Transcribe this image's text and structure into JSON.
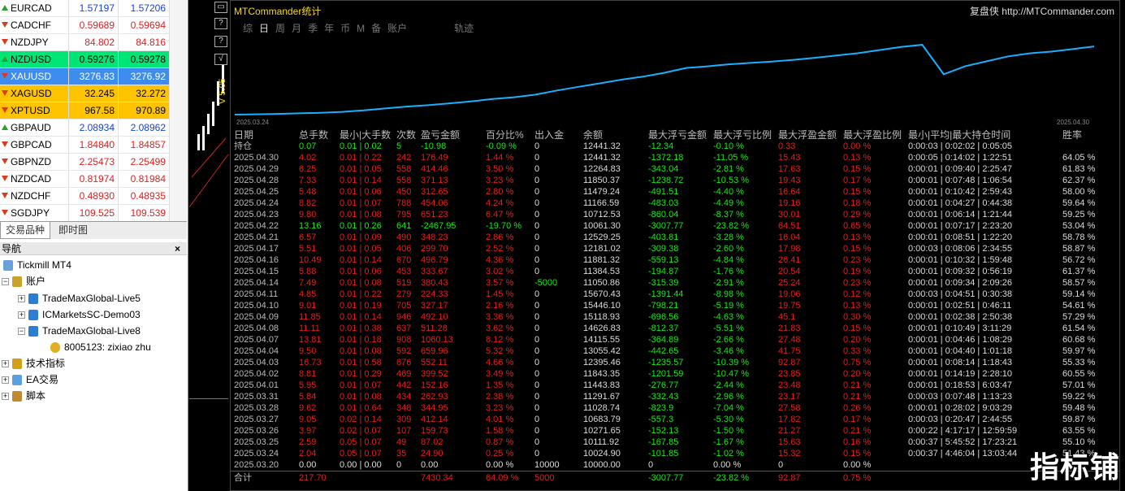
{
  "market_watch": {
    "rows": [
      {
        "sym": "EURCAD",
        "bid": "1.57197",
        "ask": "1.57206",
        "dir": "up",
        "hl": ""
      },
      {
        "sym": "CADCHF",
        "bid": "0.59689",
        "ask": "0.59694",
        "dir": "dn",
        "hl": ""
      },
      {
        "sym": "NZDJPY",
        "bid": "84.802",
        "ask": "84.816",
        "dir": "dn",
        "hl": ""
      },
      {
        "sym": "NZDUSD",
        "bid": "0.59276",
        "ask": "0.59278",
        "dir": "up",
        "hl": "green"
      },
      {
        "sym": "XAUUSD",
        "bid": "3276.83",
        "ask": "3276.92",
        "dir": "dn",
        "hl": "blue"
      },
      {
        "sym": "XAGUSD",
        "bid": "32.245",
        "ask": "32.272",
        "dir": "dn",
        "hl": "orange"
      },
      {
        "sym": "XPTUSD",
        "bid": "967.58",
        "ask": "970.89",
        "dir": "dn",
        "hl": "orange"
      },
      {
        "sym": "GBPAUD",
        "bid": "2.08934",
        "ask": "2.08962",
        "dir": "up",
        "hl": ""
      },
      {
        "sym": "GBPCAD",
        "bid": "1.84840",
        "ask": "1.84857",
        "dir": "dn",
        "hl": ""
      },
      {
        "sym": "GBPNZD",
        "bid": "2.25473",
        "ask": "2.25499",
        "dir": "dn",
        "hl": ""
      },
      {
        "sym": "NZDCAD",
        "bid": "0.81974",
        "ask": "0.81984",
        "dir": "dn",
        "hl": ""
      },
      {
        "sym": "NZDCHF",
        "bid": "0.48930",
        "ask": "0.48935",
        "dir": "dn",
        "hl": ""
      },
      {
        "sym": "SGDJPY",
        "bid": "109.525",
        "ask": "109.539",
        "dir": "dn",
        "hl": ""
      }
    ],
    "tabs": [
      "交易品种",
      "即时图"
    ]
  },
  "navigator": {
    "title": "导航",
    "broker": "Tickmill MT4",
    "accounts": "账户",
    "acc1": "TradeMaxGlobal-Live5",
    "acc2": "ICMarketsSC-Demo03",
    "acc3": "TradeMaxGlobal-Live8",
    "acc3_user": "8005123: zixiao zhu",
    "indicators": "技术指标",
    "ea": "EA交易",
    "scripts": "脚本"
  },
  "toolbar_buttons": [
    "▭",
    "?",
    "?",
    "√"
  ],
  "vertical_label": "V 5.05",
  "panel": {
    "title": "MTCommander统计",
    "link_prefix": "复盘侠",
    "link": "http://MTCommander.com",
    "tabs": [
      "综",
      "日",
      "周",
      "月",
      "季",
      "年",
      "币",
      "M",
      "备",
      "账户"
    ],
    "active_tab": "日",
    "track": "轨迹",
    "graph_start": "2025.03.24",
    "graph_end": "2025.04.30",
    "curve": [
      0,
      0.4,
      1.0,
      1.7,
      2.4,
      3.6,
      5.5,
      8.1,
      10.5,
      12.3,
      14.8,
      17.3,
      20.4,
      22.8,
      26.2,
      31.6,
      36.4,
      41.0,
      45.7,
      49.7,
      54.8,
      61.1,
      63.2,
      65.9,
      67.7,
      69.5,
      71.7,
      74.4,
      77.3,
      80.3,
      84.5,
      88.5,
      91.4,
      52.8,
      63.4,
      69.8,
      76.3,
      80.2,
      82.5,
      85.7,
      89.3
    ],
    "headers": [
      "日期",
      "总手数",
      "最小|大手数",
      "次数",
      "盈亏金额",
      "百分比%",
      "出入金",
      "余额",
      "最大浮亏金额",
      "最大浮亏比例",
      "最大浮盈金额",
      "最大浮盈比例",
      "最小|平均|最大持仓时间",
      "胜率"
    ],
    "holding": {
      "label": "持仓",
      "lots": "0.07",
      "minmax": "0.01 | 0.02",
      "count": "5",
      "pnl": "-10.98",
      "pct": "-0.09 %",
      "dep": "0",
      "bal": "12441.32",
      "mfl": "-12.34",
      "mflp": "-0.10 %",
      "mfp": "0.33",
      "mfpp": "0.00 %",
      "time": "0:00:03 | 0:02:02 | 0:05:05",
      "win": ""
    },
    "rows": [
      [
        "2025.04.30",
        "4.02",
        "0.01 | 0.22",
        "242",
        "176.49",
        "1.44 %",
        "0",
        "12441.32",
        "-1372.18",
        "-11.05 %",
        "15.43",
        "0.13 %",
        "0:00:05 | 0:14:02 | 1:22:51",
        "64.05 %"
      ],
      [
        "2025.04.29",
        "6.25",
        "0.01 | 0.05",
        "558",
        "414.46",
        "3.50 %",
        "0",
        "12264.83",
        "-343.04",
        "-2.81 %",
        "17.63",
        "0.15 %",
        "0:00:01 | 0:09:40 | 2:25:47",
        "61.83 %"
      ],
      [
        "2025.04.28",
        "7.33",
        "0.01 | 0.14",
        "558",
        "371.13",
        "3.23 %",
        "0",
        "11850.37",
        "-1238.72",
        "-10.53 %",
        "19.43",
        "0.17 %",
        "0:00:01 | 0:07:48 | 1:06:54",
        "62.37 %"
      ],
      [
        "2025.04.25",
        "5.48",
        "0.01 | 0.06",
        "450",
        "312.65",
        "2.80 %",
        "0",
        "11479.24",
        "-491.51",
        "-4.40 %",
        "16.64",
        "0.15 %",
        "0:00:01 | 0:10:42 | 2:59:43",
        "58.00 %"
      ],
      [
        "2025.04.24",
        "8.82",
        "0.01 | 0.07",
        "788",
        "454.06",
        "4.24 %",
        "0",
        "11166.59",
        "-483.03",
        "-4.49 %",
        "19.16",
        "0.18 %",
        "0:00:01 | 0:04:27 | 0:44:38",
        "59.64 %"
      ],
      [
        "2025.04.23",
        "9.80",
        "0.01 | 0.08",
        "795",
        "651.23",
        "6.47 %",
        "0",
        "10712.53",
        "-860.04",
        "-8.37 %",
        "30.01",
        "0.29 %",
        "0:00:01 | 0:06:14 | 1:21:44",
        "59.25 %"
      ],
      [
        "2025.04.22",
        "13.16",
        "0.01 | 0.26",
        "641",
        "-2467.95",
        "-19.70 %",
        "0",
        "10061.30",
        "-3007.77",
        "-23.82 %",
        "64.51",
        "0.65 %",
        "0:00:01 | 0:07:17 | 2:23:20",
        "53.04 %"
      ],
      [
        "2025.04.21",
        "6.57",
        "0.01 | 0.09",
        "490",
        "348.23",
        "2.86 %",
        "0",
        "12529.25",
        "-403.81",
        "-3.28 %",
        "16.04",
        "0.13 %",
        "0:00:01 | 0:08:51 | 1:22:20",
        "58.78 %"
      ],
      [
        "2025.04.17",
        "5.51",
        "0.01 | 0.05",
        "406",
        "299.70",
        "2.52 %",
        "0",
        "12181.02",
        "-309.38",
        "-2.60 %",
        "17.98",
        "0.15 %",
        "0:00:03 | 0:08:06 | 2:34:55",
        "58.87 %"
      ],
      [
        "2025.04.16",
        "10.49",
        "0.01 | 0.14",
        "670",
        "496.79",
        "4.36 %",
        "0",
        "11881.32",
        "-559.13",
        "-4.84 %",
        "26.41",
        "0.23 %",
        "0:00:01 | 0:10:32 | 1:59:48",
        "56.72 %"
      ],
      [
        "2025.04.15",
        "5.88",
        "0.01 | 0.06",
        "453",
        "333.67",
        "3.02 %",
        "0",
        "11384.53",
        "-194.87",
        "-1.76 %",
        "20.54",
        "0.19 %",
        "0:00:01 | 0:09:32 | 0:56:19",
        "61.37 %"
      ],
      [
        "2025.04.14",
        "7.49",
        "0.01 | 0.08",
        "519",
        "380.43",
        "3.57 %",
        "-5000",
        "11050.86",
        "-315.39",
        "-2.91 %",
        "25.24",
        "0.23 %",
        "0:00:01 | 0:09:34 | 2:09:26",
        "58.57 %"
      ],
      [
        "2025.04.11",
        "4.85",
        "0.01 | 0.22",
        "279",
        "224.33",
        "1.45 %",
        "0",
        "15670.43",
        "-1391.44",
        "-8.98 %",
        "19.06",
        "0.12 %",
        "0:00:03 | 0:04:51 | 0:30:38",
        "59.14 %"
      ],
      [
        "2025.04.10",
        "9.01",
        "0.01 | 0.19",
        "705",
        "327.17",
        "2.16 %",
        "0",
        "15446.10",
        "-798.21",
        "-5.19 %",
        "19.75",
        "0.13 %",
        "0:00:01 | 0:02:51 | 0:46:11",
        "54.61 %"
      ],
      [
        "2025.04.09",
        "11.85",
        "0.01 | 0.14",
        "946",
        "492.10",
        "3.36 %",
        "0",
        "15118.93",
        "-696.56",
        "-4.63 %",
        "45.1",
        "0.30 %",
        "0:00:01 | 0:02:38 | 2:50:38",
        "57.29 %"
      ],
      [
        "2025.04.08",
        "11.11",
        "0.01 | 0.38",
        "637",
        "511.28",
        "3.62 %",
        "0",
        "14626.83",
        "-812.37",
        "-5.51 %",
        "21.83",
        "0.15 %",
        "0:00:01 | 0:10:49 | 3:11:29",
        "61.54 %"
      ],
      [
        "2025.04.07",
        "13.81",
        "0.01 | 0.18",
        "908",
        "1060.13",
        "8.12 %",
        "0",
        "14115.55",
        "-364.89",
        "-2.66 %",
        "27.48",
        "0.20 %",
        "0:00:01 | 0:04:46 | 1:08:29",
        "60.68 %"
      ],
      [
        "2025.04.04",
        "9.50",
        "0.01 | 0.08",
        "592",
        "659.96",
        "5.32 %",
        "0",
        "13055.42",
        "-442.65",
        "-3.46 %",
        "41.75",
        "0.33 %",
        "0:00:01 | 0:04:40 | 1:01:18",
        "59.97 %"
      ],
      [
        "2025.04.03",
        "16.73",
        "0.01 | 0.58",
        "676",
        "552.11",
        "4.66 %",
        "0",
        "12395.46",
        "-1235.57",
        "-10.39 %",
        "92.87",
        "0.75 %",
        "0:00:01 | 0:08:14 | 1:18:43",
        "55.33 %"
      ],
      [
        "2025.04.02",
        "8.81",
        "0.01 | 0.29",
        "469",
        "399.52",
        "3.49 %",
        "0",
        "11843.35",
        "-1201.59",
        "-10.47 %",
        "23.85",
        "0.20 %",
        "0:00:01 | 0:14:19 | 2:28:10",
        "60.55 %"
      ],
      [
        "2025.04.01",
        "5.95",
        "0.01 | 0.07",
        "442",
        "152.16",
        "1.35 %",
        "0",
        "11443.83",
        "-276.77",
        "-2.44 %",
        "23.48",
        "0.21 %",
        "0:00:01 | 0:18:53 | 6:03:47",
        "57.01 %"
      ],
      [
        "2025.03.31",
        "5.84",
        "0.01 | 0.08",
        "434",
        "262.93",
        "2.38 %",
        "0",
        "11291.67",
        "-332.43",
        "-2.96 %",
        "23.17",
        "0.21 %",
        "0:00:03 | 0:07:48 | 1:13:23",
        "59.22 %"
      ],
      [
        "2025.03.28",
        "9.62",
        "0.01 | 0.64",
        "348",
        "344.95",
        "3.23 %",
        "0",
        "11028.74",
        "-823.9",
        "-7.04 %",
        "27.58",
        "0.26 %",
        "0:00:01 | 0:28:02 | 9:03:29",
        "59.48 %"
      ],
      [
        "2025.03.27",
        "9.05",
        "0.02 | 0.14",
        "309",
        "412.14",
        "4.01 %",
        "0",
        "10683.79",
        "-557.3",
        "-5.30 %",
        "17.82",
        "0.17 %",
        "0:00:03 | 0:20:47 | 2:44:55",
        "59.87 %"
      ],
      [
        "2025.03.26",
        "3.97",
        "0.02 | 0.07",
        "107",
        "159.73",
        "1.58 %",
        "0",
        "10271.65",
        "-152.13",
        "-1.50 %",
        "21.27",
        "0.21 %",
        "0:00:22 | 4:17:17 | 12:59:59",
        "63.55 %"
      ],
      [
        "2025.03.25",
        "2.59",
        "0.05 | 0.07",
        "49",
        "87.02",
        "0.87 %",
        "0",
        "10111.92",
        "-167.85",
        "-1.67 %",
        "15.63",
        "0.16 %",
        "0:00:37 | 5:45:52 | 17:23:21",
        "55.10 %"
      ],
      [
        "2025.03.24",
        "2.04",
        "0.05 | 0.07",
        "35",
        "24.90",
        "0.25 %",
        "0",
        "10024.90",
        "-101.85",
        "-1.02 %",
        "15.32",
        "0.15 %",
        "0:00:37 | 4:46:04 | 13:03:44",
        "51.43 %"
      ],
      [
        "2025.03.20",
        "0.00",
        "0.00 | 0.00",
        "0",
        "0.00",
        "0.00 %",
        "10000",
        "10000.00",
        "0",
        "0.00 %",
        "0",
        "0.00 %",
        "",
        ""
      ]
    ],
    "total": {
      "label": "合计",
      "lots": "217.70",
      "pnl": "7430.34",
      "pct": "64.09 %",
      "dep": "5000",
      "mfl": "-3007.77",
      "mflp": "-23.82 %",
      "mfp": "92.87",
      "mfpp": "0.75 %"
    }
  },
  "watermark": "指标铺",
  "colors": {
    "green": "#19e519",
    "red": "#e0201e",
    "curve": "#1ab0ff",
    "title": "#ffd800"
  }
}
